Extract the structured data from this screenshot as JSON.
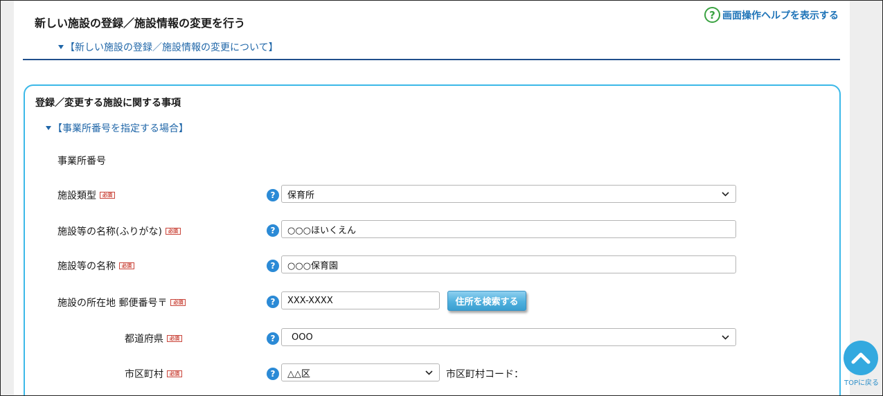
{
  "header": {
    "title": "新しい施設の登録／施設情報の変更を行う",
    "help_link": "画面操作ヘルプを表示する",
    "help_icon": "?",
    "about_link": "【新しい施設の登録／施設情報の変更について】"
  },
  "section": {
    "title": "登録／変更する施設に関する事項",
    "office_link": "【事業所番号を指定する場合】"
  },
  "required_badge": "必須",
  "help_mark": "?",
  "form": {
    "office_number": {
      "label": "事業所番号"
    },
    "facility_type": {
      "label": "施設類型",
      "value": "保育所"
    },
    "name_kana": {
      "label": "施設等の名称(ふりがな)",
      "value": "○○○ほいくえん"
    },
    "name": {
      "label": "施設等の名称",
      "value": "○○○保育園"
    },
    "postal": {
      "label": "施設の所在地 郵便番号〒",
      "value": "XXX-XXXX",
      "search_button": "住所を検索する"
    },
    "prefecture": {
      "label": "都道府県",
      "value": "OOO"
    },
    "city": {
      "label": "市区町村",
      "value": "△△区",
      "code_label": "市区町村コード："
    }
  },
  "page_top": {
    "label": "TOPに戻る"
  },
  "colors": {
    "accent": "#1f74b8",
    "section_border": "#3bb8e8",
    "help_green": "#3aa241",
    "required_red": "#c9483e"
  }
}
